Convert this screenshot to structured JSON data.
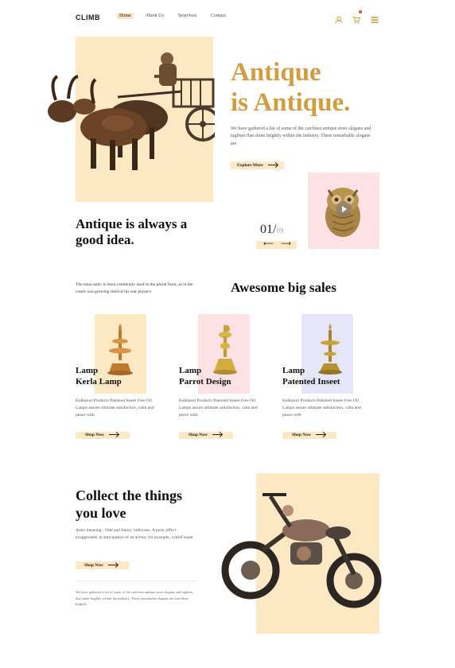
{
  "header": {
    "logo": "CLIMB",
    "nav": [
      "Home",
      "About Us",
      "Seurvices",
      "Contact"
    ],
    "icons": [
      "user-icon",
      "cart-icon",
      "menu-icon"
    ]
  },
  "hero": {
    "title_line1": "Antique",
    "title_line2": "is Antique.",
    "description": "We have gathered a list of some of the catchiest antique store slogans and taglines that shine brightly within the industry. These remarkable slogans are",
    "button": "Explore More"
  },
  "showcase": {
    "title": "Antique is always a good idea.",
    "counter_current": "01/",
    "counter_total": "09"
  },
  "quote": "The noun antic is most commonly used in the plural form, as in the coach was growing tired of his star player's",
  "sales": {
    "title": "Awesome big sales",
    "products": [
      {
        "line1": "Lamp",
        "line2": "Kerla Lamp",
        "desc": "Kalkipuri Products Patented Inseet Free Oil Lamps assure ultimate satisfaction, calm and peace with",
        "button": "Shop Now"
      },
      {
        "line1": "Lamp",
        "line2": "Parrot Design",
        "desc": "Kalkipuri Products Patented Inseet Free Oil Lamps assure ultimate satisfaction, calm and peace with",
        "button": "Shop Now"
      },
      {
        "line1": "Lamp",
        "line2": "Patented Inseet",
        "desc": "Kalkipuri Products Patented Inseet Free Oil Lamps assure ultimate satisfaction, calm and peace with",
        "button": "Shop Now"
      }
    ]
  },
  "collect": {
    "title_line1": "Collect the things",
    "title_line2": "you love",
    "description": "Antic meaning - Odd and funny; ludicrous. A pose, effect exaggerated, in anticipation of an action; for example, a brief squat",
    "button": "Shop Now",
    "note": "We have gathered a list of some of the catchiest antique store slogans and taglines that shine brightly within the industry. These remarkable slogans are that shine brightly"
  },
  "colors": {
    "accent": "#d39c3f",
    "cream": "#fde8c4",
    "pink": "#fde1e4",
    "lavender": "#e6e6fb"
  }
}
